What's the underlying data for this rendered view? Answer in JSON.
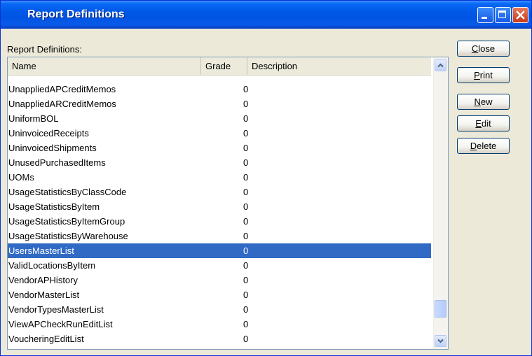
{
  "window": {
    "title": "Report Definitions"
  },
  "list": {
    "label": "Report Definitions:",
    "columns": {
      "name": "Name",
      "grade": "Grade",
      "description": "Description"
    },
    "rows": [
      {
        "name": "UnappliedAPCreditMemos",
        "grade": "0"
      },
      {
        "name": "UnappliedARCreditMemos",
        "grade": "0"
      },
      {
        "name": "UniformBOL",
        "grade": "0"
      },
      {
        "name": "UninvoicedReceipts",
        "grade": "0"
      },
      {
        "name": "UninvoicedShipments",
        "grade": "0"
      },
      {
        "name": "UnusedPurchasedItems",
        "grade": "0"
      },
      {
        "name": "UOMs",
        "grade": "0"
      },
      {
        "name": "UsageStatisticsByClassCode",
        "grade": "0"
      },
      {
        "name": "UsageStatisticsByItem",
        "grade": "0"
      },
      {
        "name": "UsageStatisticsByItemGroup",
        "grade": "0"
      },
      {
        "name": "UsageStatisticsByWarehouse",
        "grade": "0"
      },
      {
        "name": "UsersMasterList",
        "grade": "0"
      },
      {
        "name": "ValidLocationsByItem",
        "grade": "0"
      },
      {
        "name": "VendorAPHistory",
        "grade": "0"
      },
      {
        "name": "VendorMasterList",
        "grade": "0"
      },
      {
        "name": "VendorTypesMasterList",
        "grade": "0"
      },
      {
        "name": "ViewAPCheckRunEditList",
        "grade": "0"
      },
      {
        "name": "VoucheringEditList",
        "grade": "0"
      }
    ],
    "selected_row": "UsersMasterList"
  },
  "buttons": {
    "close": {
      "mnemonic": "C",
      "rest": "lose"
    },
    "print": {
      "mnemonic": "P",
      "rest": "rint"
    },
    "new": {
      "mnemonic": "N",
      "rest": "ew"
    },
    "edit": {
      "mnemonic": "E",
      "rest": "dit"
    },
    "delete": {
      "mnemonic": "D",
      "rest": "elete"
    }
  },
  "colors": {
    "titlebar": "#0054e3",
    "selection": "#316ac5",
    "dialog_background": "#ece9d8"
  },
  "icons": {
    "minimize": "minimize-icon",
    "maximize": "maximize-icon",
    "close": "close-icon",
    "scroll_up": "chevron-up-icon",
    "scroll_down": "chevron-down-icon"
  }
}
